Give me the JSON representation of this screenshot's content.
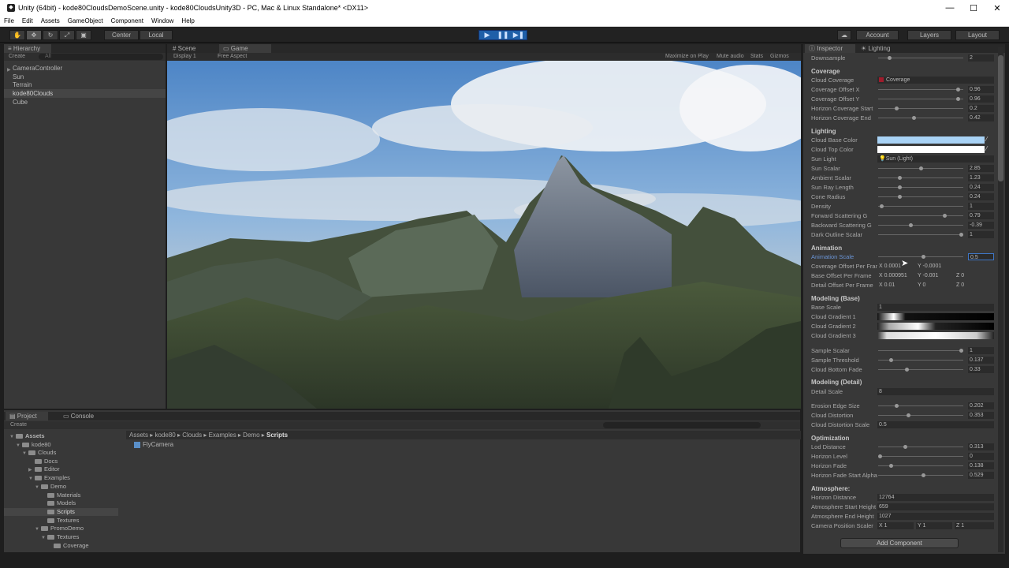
{
  "window": {
    "title": "Unity (64bit) - kode80CloudsDemoScene.unity - kode80CloudsUnity3D - PC, Mac & Linux Standalone* <DX11>",
    "min": "—",
    "max": "☐",
    "close": "✕"
  },
  "menu": [
    "File",
    "Edit",
    "Assets",
    "GameObject",
    "Component",
    "Window",
    "Help"
  ],
  "toolbar": {
    "center": "Center",
    "local": "Local",
    "account": "Account",
    "layers": "Layers",
    "layout": "Layout"
  },
  "hierarchy": {
    "tab": "Hierarchy",
    "create": "Create",
    "search_placeholder": "All",
    "items": [
      "CameraController",
      "Sun",
      "Terrain",
      "kode80Clouds",
      "Cube"
    ],
    "selected_index": 3
  },
  "view_tabs": {
    "scene": "Scene",
    "game": "Game"
  },
  "game_bar": {
    "display": "Display 1",
    "aspect": "Free Aspect",
    "maximize": "Maximize on Play",
    "mute": "Mute audio",
    "stats": "Stats",
    "gizmos": "Gizmos"
  },
  "project": {
    "tab": "Project",
    "console": "Console",
    "create": "Create",
    "breadcrumb": [
      "Assets",
      "kode80",
      "Clouds",
      "Examples",
      "Demo",
      "Scripts"
    ],
    "file": "FlyCamera",
    "tree": [
      {
        "label": "Assets",
        "depth": 0,
        "open": true,
        "bold": true
      },
      {
        "label": "kode80",
        "depth": 1,
        "open": true
      },
      {
        "label": "Clouds",
        "depth": 2,
        "open": true
      },
      {
        "label": "Docs",
        "depth": 3
      },
      {
        "label": "Editor",
        "depth": 3,
        "closed": true
      },
      {
        "label": "Examples",
        "depth": 3,
        "open": true
      },
      {
        "label": "Demo",
        "depth": 4,
        "open": true
      },
      {
        "label": "Materials",
        "depth": 5
      },
      {
        "label": "Models",
        "depth": 5
      },
      {
        "label": "Scripts",
        "depth": 5,
        "selected": true
      },
      {
        "label": "Textures",
        "depth": 5
      },
      {
        "label": "PromoDemo",
        "depth": 4,
        "open": true
      },
      {
        "label": "Textures",
        "depth": 5,
        "open": true
      },
      {
        "label": "Coverage",
        "depth": 6
      }
    ]
  },
  "inspector": {
    "tab": "Inspector",
    "lighting_tab": "Lighting",
    "downsample_label": "Downsample",
    "downsample": "2",
    "coverage": {
      "head": "Coverage",
      "cloud_coverage_label": "Cloud Coverage",
      "cloud_coverage": "Coverage",
      "rows": [
        {
          "label": "Coverage Offset X",
          "val": "0.96",
          "pos": 0.96
        },
        {
          "label": "Coverage Offset Y",
          "val": "0.96",
          "pos": 0.96
        },
        {
          "label": "Horizon Coverage Start",
          "val": "0.2",
          "pos": 0.2
        },
        {
          "label": "Horizon Coverage End",
          "val": "0.42",
          "pos": 0.42
        }
      ]
    },
    "lighting": {
      "head": "Lighting",
      "base_color_label": "Cloud Base Color",
      "base_color": "#a8d2f5",
      "top_color_label": "Cloud Top Color",
      "top_color": "#ffffff",
      "sun_label": "Sun Light",
      "sun": "Sun (Light)",
      "rows": [
        {
          "label": "Sun Scalar",
          "val": "2.85",
          "pos": 0.5
        },
        {
          "label": "Ambient Scalar",
          "val": "1.23",
          "pos": 0.24
        },
        {
          "label": "Sun Ray Length",
          "val": "0.24",
          "pos": 0.24
        },
        {
          "label": "Cone Radius",
          "val": "0.24",
          "pos": 0.24
        },
        {
          "label": "Density",
          "val": "1",
          "pos": 0.02
        },
        {
          "label": "Forward Scattering G",
          "val": "0.79",
          "pos": 0.8
        },
        {
          "label": "Backward Scattering G",
          "val": "-0.39",
          "pos": 0.38
        },
        {
          "label": "Dark Outline Scalar",
          "val": "1",
          "pos": 1
        }
      ]
    },
    "animation": {
      "head": "Animation",
      "scale_label": "Animation Scale",
      "scale": "0.5",
      "offset_rows": [
        {
          "label": "Coverage Offset Per Frame",
          "x": "0.0001",
          "y": "-0.0001",
          "z": null
        },
        {
          "label": "Base Offset Per Frame",
          "x": "0.000951",
          "y": "-0.001",
          "z": "0"
        },
        {
          "label": "Detail Offset Per Frame",
          "x": "0.01",
          "y": "0",
          "z": "0"
        }
      ]
    },
    "modeling_base": {
      "head": "Modeling (Base)",
      "base_scale_label": "Base Scale",
      "base_scale": "1",
      "gradients": [
        "Cloud Gradient 1",
        "Cloud Gradient 2",
        "Cloud Gradient 3"
      ],
      "rows": [
        {
          "label": "Sample Scalar",
          "val": "1",
          "pos": 1
        },
        {
          "label": "Sample Threshold",
          "val": "0.137",
          "pos": 0.14
        },
        {
          "label": "Cloud Bottom Fade",
          "val": "0.33",
          "pos": 0.33
        }
      ]
    },
    "modeling_detail": {
      "head": "Modeling (Detail)",
      "detail_scale_label": "Detail Scale",
      "detail_scale": "8",
      "rows": [
        {
          "label": "Erosion Edge Size",
          "val": "0.202",
          "pos": 0.2
        },
        {
          "label": "Cloud Distortion",
          "val": "0.353",
          "pos": 0.35
        }
      ],
      "distortion_scale_label": "Cloud Distortion Scale",
      "distortion_scale": "0.5"
    },
    "optimization": {
      "head": "Optimization",
      "rows": [
        {
          "label": "Lod Distance",
          "val": "0.313",
          "pos": 0.31
        },
        {
          "label": "Horizon Level",
          "val": "0",
          "pos": 0
        },
        {
          "label": "Horizon Fade",
          "val": "0.138",
          "pos": 0.14
        },
        {
          "label": "Horizon Fade Start Alpha",
          "val": "0.529",
          "pos": 0.53
        }
      ]
    },
    "atmosphere": {
      "head": "Atmosphere:",
      "rows": [
        {
          "label": "Horizon Distance",
          "val": "12764"
        },
        {
          "label": "Atmosphere Start Height",
          "val": "659"
        },
        {
          "label": "Atmosphere End Height",
          "val": "1027"
        }
      ],
      "cam_label": "Camera Position Scaler",
      "cam_x": "1",
      "cam_y": "1",
      "cam_z": "1"
    },
    "add_component": "Add Component"
  }
}
